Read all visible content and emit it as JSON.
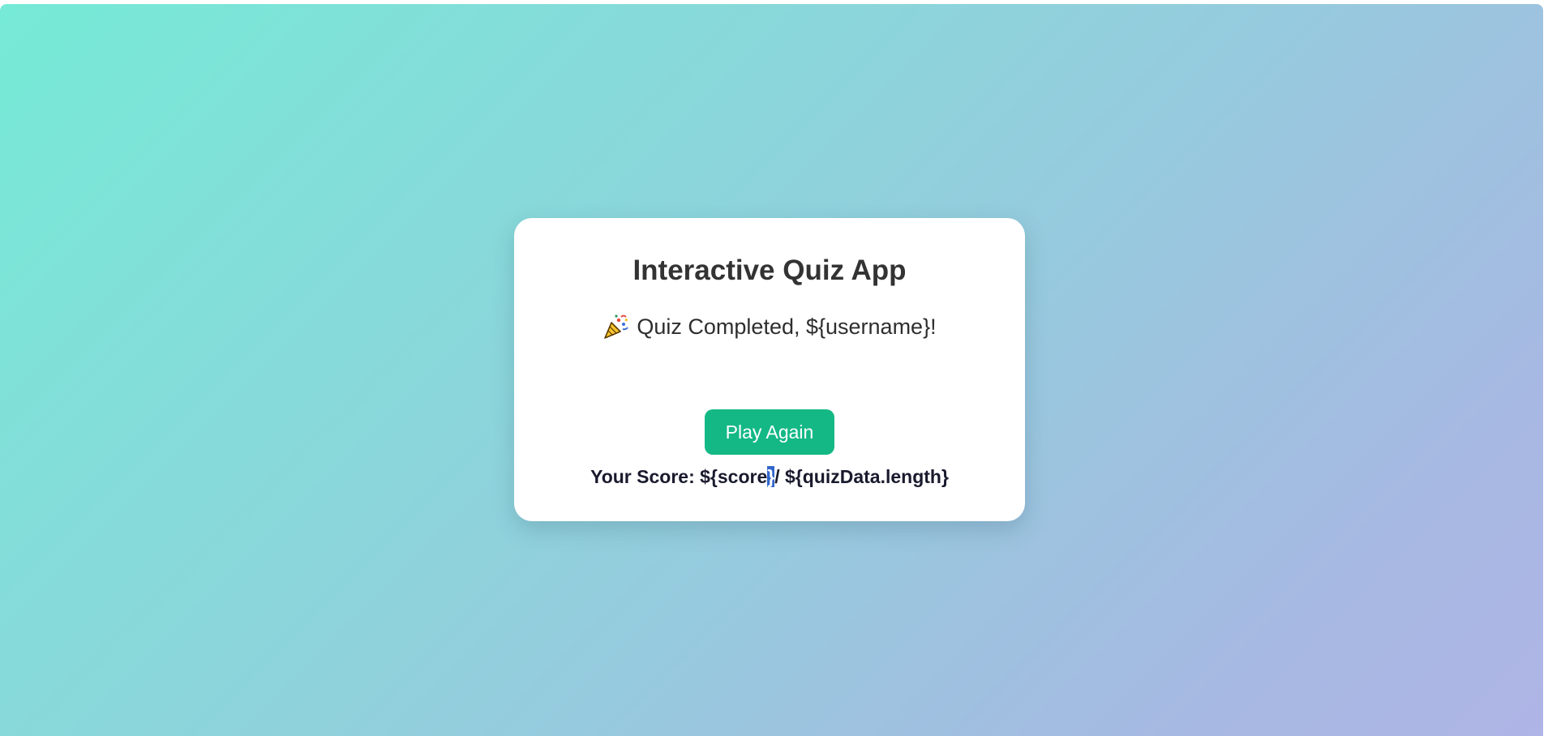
{
  "app": {
    "title": "Interactive Quiz App"
  },
  "result": {
    "icon": "party-popper-icon",
    "message": "Quiz Completed, ${username}!",
    "play_again_label": "Play Again",
    "score_prefix": "Your Score: ${score",
    "score_selected": "}",
    "score_suffix": "/ ${quizData.length}"
  },
  "colors": {
    "button": "#14b885",
    "selection": "#3366cc"
  }
}
